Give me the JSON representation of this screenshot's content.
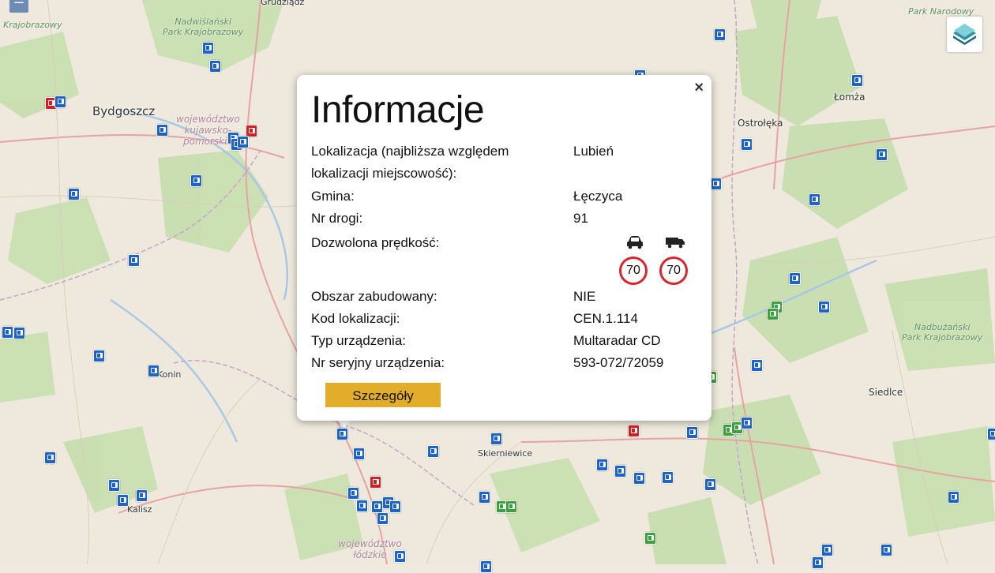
{
  "map": {
    "cities": [
      "Bydgoszcz",
      "Łomża",
      "Ostrołęka",
      "Siedlce",
      "Skierniewice",
      "Kalisz",
      "Konin",
      "Grudziądz"
    ],
    "parks": [
      "Nadwiślański\nPark Krajobrazowy",
      "Nadbużański\nPark Krajobrazowy",
      "Park Narodowy",
      "Krajobrazowy"
    ],
    "regions": [
      "województwo\nkujawsko-\npomorskie",
      "województwo\nłódzkie"
    ],
    "colors": {
      "camera_blue": "#1e63c9",
      "camera_red": "#d31f24",
      "camera_green": "#3aa23a"
    }
  },
  "controls": {
    "zoom_out": "−",
    "layers_icon": "layers-icon"
  },
  "popup": {
    "title": "Informacje",
    "close": "×",
    "rows": [
      {
        "label": "Lokalizacja (najbliższa względem lokalizacji miejscowość):",
        "value": "Lubień"
      },
      {
        "label": "Gmina:",
        "value": "Łęczyca"
      },
      {
        "label": "Nr drogi:",
        "value": "91"
      },
      {
        "label": "Dozwolona prędkość:",
        "value": ""
      },
      {
        "label": "Obszar zabudowany:",
        "value": "NIE"
      },
      {
        "label": "Kod lokalizacji:",
        "value": "CEN.1.114"
      },
      {
        "label": "Typ urządzenia:",
        "value": "Multaradar CD"
      },
      {
        "label": "Nr seryjny urządzenia:",
        "value": "593-072/72059"
      }
    ],
    "speed": {
      "car": "70",
      "truck": "70",
      "car_icon": "car-icon",
      "truck_icon": "truck-icon"
    },
    "details_button": "Szczegóły",
    "accent_color": "#e2ad2b"
  }
}
